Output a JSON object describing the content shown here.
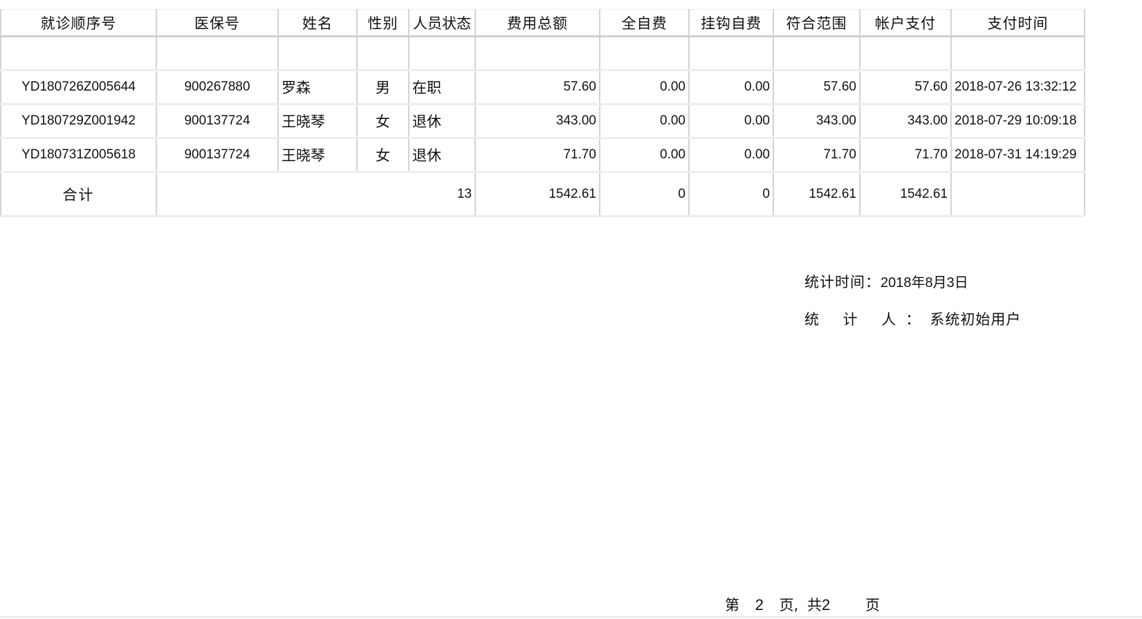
{
  "table": {
    "headers": [
      "就诊顺序号",
      "医保号",
      "姓名",
      "性别",
      "人员状态",
      "费用总额",
      "全自费",
      "挂钩自费",
      "符合范围",
      "帐户支付",
      "支付时间"
    ],
    "rows": [
      [
        "YD180726Z005644",
        "900267880",
        "罗森",
        "男",
        "在职",
        "57.60",
        "0.00",
        "0.00",
        "57.60",
        "57.60",
        "2018-07-26 13:32:12"
      ],
      [
        "YD180729Z001942",
        "900137724",
        "王晓琴",
        "女",
        "退休",
        "343.00",
        "0.00",
        "0.00",
        "343.00",
        "343.00",
        "2018-07-29 10:09:18"
      ],
      [
        "YD180731Z005618",
        "900137724",
        "王晓琴",
        "女",
        "退休",
        "71.70",
        "0.00",
        "0.00",
        "71.70",
        "71.70",
        "2018-07-31 14:19:29"
      ]
    ],
    "total": {
      "label": "合计",
      "count": "13",
      "values": [
        "1542.61",
        "0",
        "0",
        "1542.61",
        "1542.61"
      ]
    }
  },
  "footer": {
    "stat_time_label": "统计时间：",
    "stat_time_value": "2018年8月3日",
    "stat_person_label": "统 计 人：",
    "stat_person_value": "系统初始用户"
  },
  "pagination": {
    "prefix": "第",
    "current": "2",
    "middle": "页,",
    "total_prefix": "共",
    "total": "2",
    "suffix": "页"
  }
}
